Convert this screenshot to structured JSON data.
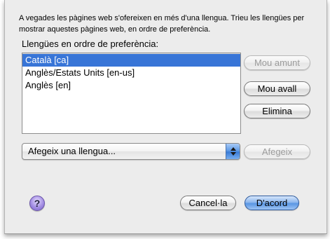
{
  "intro_text": "A vegades les pàgines web s'ofereixen en més d'una llengua. Trieu les llengües per mostrar aquestes pàgines web, en ordre de preferència.",
  "list_label": "Llengües en ordre de preferència:",
  "languages": [
    {
      "label": "Català  [ca]",
      "selected": true
    },
    {
      "label": "Anglès/Estats Units  [en-us]",
      "selected": false
    },
    {
      "label": "Anglès  [en]",
      "selected": false
    }
  ],
  "buttons": {
    "move_up": "Mou amunt",
    "move_down": "Mou avall",
    "remove": "Elimina",
    "add": "Afegeix",
    "cancel": "Cancel·la",
    "ok": "D'acord",
    "help": "?"
  },
  "add_language_popup": {
    "selected": "Afegeix una llengua..."
  },
  "icons": {
    "help": "question-mark-icon",
    "popup": "up-down-arrows-icon"
  },
  "colors": {
    "selection": "#3875d7",
    "default_button": "#5a96e3",
    "help_button": "#a38ee3"
  }
}
